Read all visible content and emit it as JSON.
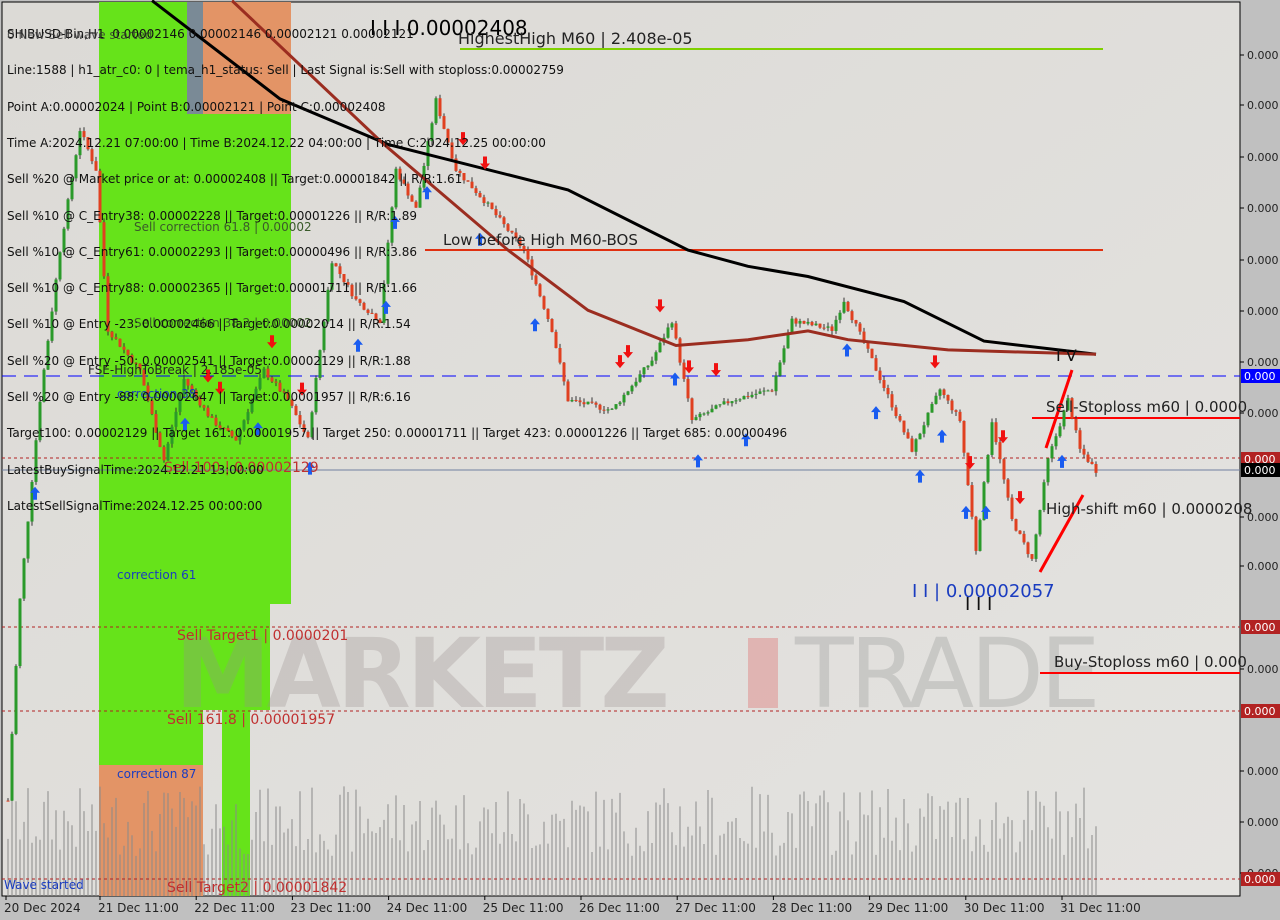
{
  "header": {
    "symbol_line": "SHIBUSD-Bin,H1  0.00002146 0.00002146 0.00002121 0.00002121",
    "lines": [
      "Line:1588 | h1_atr_c0: 0 | tema_h1_status: Sell | Last Signal is:Sell with stoploss:0.00002759",
      "Point A:0.00002024 | Point B:0.00002121 | Point C:0.00002408",
      "Time A:2024.12.21 07:00:00 | Time B:2024.12.22 04:00:00 | Time C:2024.12.25 00:00:00",
      "Sell %20 @ Market price or at: 0.00002408 || Target:0.00001842 || R/R:1.61",
      "Sell %10 @ C_Entry38: 0.00002228 || Target:0.00001226 || R/R:1.89",
      "Sell %10 @ C_Entry61: 0.00002293 || Target:0.00000496 || R/R:3.86",
      "Sell %10 @ C_Entry88: 0.00002365 || Target:0.00001711 || R/R:1.66",
      "Sell %10 @ Entry -23: 0.00002466 || Target:0.00002014 || R/R:1.54",
      "Sell %20 @ Entry -50: 0.00002541 || Target:0.00002129 || R/R:1.88",
      "Sell %20 @ Entry -88: 0.00002647 || Target:0.00001957 || R/R:6.16",
      "Target100: 0.00002129 || Target 161: 0.00001957 || Target 250: 0.00001711 || Target 423: 0.00001226 || Target 685: 0.00000496",
      "LatestBuySignalTime:2024.12.21 13:00:00",
      "LatestSellSignalTime:2024.12.25 00:00:00"
    ],
    "overlay_text": "0 New Sell wave started"
  },
  "annotations": {
    "wave_iii_top": "I I I 0.00002408",
    "highest_high": "HighestHigh   M60 | 2.408e-05",
    "low_before_high": "Low before High   M60-BOS",
    "sell_corr_618": "Sell correction 61.8 | 0.00002",
    "sell_corr_382": "Sell correction 38.2 | 0.00002",
    "fse": "FSE-HighToBreak | 2.185e-05",
    "corr38": "correction 38",
    "sell100": "Sell 100 | 0.00002129",
    "corr61": "correction 61",
    "sell_target1": "Sell Target1 | 0.0000201",
    "sell_1618": "Sell 161.8 | 0.00001957",
    "corr87": "correction 87",
    "sell_target2": "Sell Target2 | 0.00001842",
    "wave_started": "Wave started",
    "sell_stoploss": "Sell-Stoploss m60 | 0.0000",
    "high_shift": "High-shift m60 | 0.0000208",
    "wave_ii": "I I | 0.00002057",
    "wave_iii": "I I I",
    "wave_iv": "I V",
    "buy_stoploss": "Buy-Stoploss m60 | 0.000",
    "watermark_left": "MARKETZ",
    "watermark_right": "TRADE"
  },
  "price_axis": {
    "ticks": [
      "0.000",
      "0.000",
      "0.000",
      "0.000",
      "0.000",
      "0.000",
      "0.000",
      "0.000",
      "0.000",
      "0.000",
      "0.000",
      "0.000",
      "0.000",
      "0.000"
    ],
    "markers": [
      {
        "label": "0.000",
        "color": "#0000ff"
      },
      {
        "label": "0.000",
        "color": "#b22222"
      },
      {
        "label": "0.000",
        "color": "#000000"
      },
      {
        "label": "0.000",
        "color": "#b22222"
      },
      {
        "label": "0.000",
        "color": "#b22222"
      },
      {
        "label": "0.000",
        "color": "#b22222"
      }
    ]
  },
  "time_axis": [
    "20 Dec 2024",
    "21 Dec 11:00",
    "22 Dec 11:00",
    "23 Dec 11:00",
    "24 Dec 11:00",
    "25 Dec 11:00",
    "26 Dec 11:00",
    "27 Dec 11:00",
    "28 Dec 11:00",
    "29 Dec 11:00",
    "30 Dec 11:00",
    "31 Dec 11:00"
  ],
  "chart_data": {
    "type": "candlestick",
    "symbol": "SHIBUSD-Bin",
    "timeframe": "H1",
    "ylim": [
      1.82e-05,
      2.44e-05
    ],
    "levels": {
      "highest_high": 2.408e-05,
      "low_before_high": 2.271e-05,
      "fse_high_to_break": 2.185e-05,
      "sell_100": 2.129e-05,
      "current": 2.121e-05,
      "sell_target1": 2.01e-05,
      "sell_161_8": 1.957e-05,
      "sell_target2": 1.842e-05,
      "sell_stoploss": 2.15e-05,
      "buy_stoploss": 1.98e-05
    },
    "price_path": [
      [
        "2024-12-20 12:00",
        1.896e-05
      ],
      [
        "2024-12-20 15:00",
        2.033e-05
      ],
      [
        "2024-12-20 20:00",
        2.169e-05
      ],
      [
        "2024-12-21 01:00",
        2.271e-05
      ],
      [
        "2024-12-21 06:00",
        2.353e-05
      ],
      [
        "2024-12-21 10:00",
        2.326e-05
      ],
      [
        "2024-12-21 13:00",
        2.217e-05
      ],
      [
        "2024-12-21 21:00",
        2.189e-05
      ],
      [
        "2024-12-22 03:00",
        2.128e-05
      ],
      [
        "2024-12-22 08:00",
        2.183e-05
      ],
      [
        "2024-12-22 15:00",
        2.155e-05
      ],
      [
        "2024-12-22 21:00",
        2.142e-05
      ],
      [
        "2024-12-23 04:00",
        2.189e-05
      ],
      [
        "2024-12-23 10:00",
        2.169e-05
      ],
      [
        "2024-12-23 15:00",
        2.142e-05
      ],
      [
        "2024-12-23 21:00",
        2.264e-05
      ],
      [
        "2024-12-24 03:00",
        2.237e-05
      ],
      [
        "2024-12-24 09:00",
        2.223e-05
      ],
      [
        "2024-12-24 13:00",
        2.326e-05
      ],
      [
        "2024-12-24 18:00",
        2.299e-05
      ],
      [
        "2024-12-24 23:00",
        2.373e-05
      ],
      [
        "2024-12-25 04:00",
        2.326e-05
      ],
      [
        "2024-12-25 11:00",
        2.305e-05
      ],
      [
        "2024-12-25 21:00",
        2.271e-05
      ],
      [
        "2024-12-26 04:00",
        2.217e-05
      ],
      [
        "2024-12-26 08:00",
        2.169e-05
      ],
      [
        "2024-12-26 19:00",
        2.162e-05
      ],
      [
        "2024-12-27 05:00",
        2.196e-05
      ],
      [
        "2024-12-27 10:00",
        2.223e-05
      ],
      [
        "2024-12-27 15:00",
        2.155e-05
      ],
      [
        "2024-12-28 01:00",
        2.169e-05
      ],
      [
        "2024-12-28 11:00",
        2.176e-05
      ],
      [
        "2024-12-28 16:00",
        2.223e-05
      ],
      [
        "2024-12-29 02:00",
        2.217e-05
      ],
      [
        "2024-12-29 05:00",
        2.237e-05
      ],
      [
        "2024-12-29 12:00",
        2.196e-05
      ],
      [
        "2024-12-29 22:00",
        2.135e-05
      ],
      [
        "2024-12-30 05:00",
        2.176e-05
      ],
      [
        "2024-12-30 10:00",
        2.155e-05
      ],
      [
        "2024-12-30 14:00",
        2.067e-05
      ],
      [
        "2024-12-30 18:00",
        2.155e-05
      ],
      [
        "2024-12-30 23:00",
        2.087e-05
      ],
      [
        "2024-12-31 04:00",
        2.06e-05
      ],
      [
        "2024-12-31 08:00",
        2.128e-05
      ],
      [
        "2024-12-31 13:00",
        2.169e-05
      ],
      [
        "2024-12-31 16:00",
        2.135e-05
      ],
      [
        "2024-12-31 20:00",
        2.121e-05
      ]
    ],
    "ma_black": [
      [
        "2024-12-22 00:00",
        2.441e-05
      ],
      [
        "2024-12-23 08:00",
        2.374e-05
      ],
      [
        "2024-12-24 11:00",
        2.343e-05
      ],
      [
        "2024-12-26 08:00",
        2.312e-05
      ],
      [
        "2024-12-27 14:00",
        2.271e-05
      ],
      [
        "2024-12-28 05:00",
        2.26e-05
      ],
      [
        "2024-12-28 20:00",
        2.253e-05
      ],
      [
        "2024-12-29 20:00",
        2.236e-05
      ],
      [
        "2024-12-30 16:00",
        2.209e-05
      ],
      [
        "2024-12-31 20:00",
        2.2e-05
      ]
    ],
    "ma_brown": [
      [
        "2024-12-22 20:00",
        2.441e-05
      ],
      [
        "2024-12-24 10:00",
        2.343e-05
      ],
      [
        "2024-12-25 17:00",
        2.271e-05
      ],
      [
        "2024-12-26 13:00",
        2.23e-05
      ],
      [
        "2024-12-27 11:00",
        2.206e-05
      ],
      [
        "2024-12-28 05:00",
        2.21e-05
      ],
      [
        "2024-12-28 20:00",
        2.216e-05
      ],
      [
        "2024-12-29 06:00",
        2.21e-05
      ],
      [
        "2024-12-30 07:00",
        2.203e-05
      ],
      [
        "2024-12-31 20:00",
        2.2e-05
      ]
    ]
  }
}
